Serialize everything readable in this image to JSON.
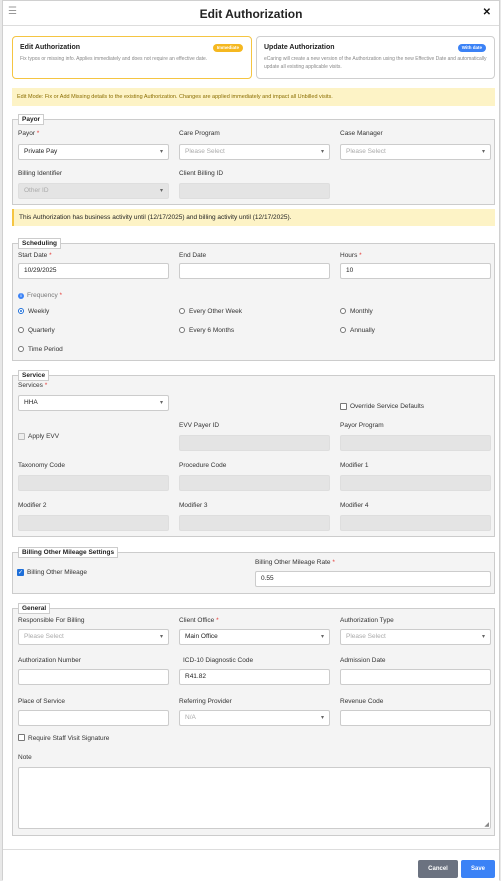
{
  "header": {
    "title": "Edit Authorization"
  },
  "cards": {
    "edit": {
      "title": "Edit Authorization",
      "badge": "Immediate",
      "desc": "Fix typos or missing info. Applies immediately and does not require an effective date."
    },
    "update": {
      "title": "Update Authorization",
      "badge": "With date",
      "desc": "eCaring will create a new version of the Authorization using the new Effective Date and automatically update all existing applicable visits."
    }
  },
  "edit_mode_note": "Edit Mode: Fix or Add Missing details to the existing Authorization. Changes are applied immediately and impact all Unbilled visits.",
  "payor": {
    "legend": "Payor",
    "payor_label": "Payor",
    "payor_value": "Private Pay",
    "care_program_label": "Care Program",
    "care_program_placeholder": "Please Select",
    "case_manager_label": "Case Manager",
    "case_manager_placeholder": "Please Select",
    "billing_identifier_label": "Billing Identifier",
    "billing_identifier_placeholder": "Other ID",
    "client_billing_id_label": "Client Billing ID"
  },
  "activity_note": "This Authorization has business activity until (12/17/2025) and billing activity until (12/17/2025).",
  "scheduling": {
    "legend": "Scheduling",
    "start_date_label": "Start Date",
    "start_date_value": "10/29/2025",
    "end_date_label": "End Date",
    "hours_label": "Hours",
    "hours_value": "10",
    "frequency_label": "Frequency",
    "options": [
      "Weekly",
      "Every Other Week",
      "Monthly",
      "Quarterly",
      "Every 6 Months",
      "Annually",
      "Time Period"
    ],
    "selected": "Weekly"
  },
  "service": {
    "legend": "Service",
    "services_label": "Services",
    "services_value": "HHA",
    "override_label": "Override Service Defaults",
    "apply_evv_label": "Apply EVV",
    "evv_payer_id_label": "EVV Payer ID",
    "payor_program_label": "Payor Program",
    "taxonomy_label": "Taxonomy Code",
    "procedure_label": "Procedure Code",
    "modifier1_label": "Modifier 1",
    "modifier2_label": "Modifier 2",
    "modifier3_label": "Modifier 3",
    "modifier4_label": "Modifier 4"
  },
  "mileage": {
    "legend": "Billing Other Mileage Settings",
    "checkbox_label": "Billing Other Mileage",
    "rate_label": "Billing Other Mileage Rate",
    "rate_value": "0.55"
  },
  "general": {
    "legend": "General",
    "responsible_label": "Responsible For Billing",
    "responsible_placeholder": "Please Select",
    "client_office_label": "Client Office",
    "client_office_value": "Main Office",
    "auth_type_label": "Authorization Type",
    "auth_type_placeholder": "Please Select",
    "auth_number_label": "Authorization Number",
    "icd10_label": "ICD-10 Diagnostic Code",
    "icd10_value": "R41.82",
    "admission_label": "Admission Date",
    "place_label": "Place of Service",
    "referring_label": "Referring Provider",
    "referring_value": "N/A",
    "revenue_label": "Revenue Code",
    "signature_label": "Require Staff Visit Signature",
    "note_label": "Note"
  },
  "footer": {
    "cancel_label": "Cancel",
    "save_label": "Save"
  },
  "colors": {
    "primary": "#3b82f6",
    "warning_bg": "#fdf3c6",
    "badge_immediate": "#f5b820",
    "required": "#e53935"
  },
  "icons": {
    "menu": "hamburger-icon",
    "close": "close-icon",
    "info": "info-icon",
    "caret": "chevron-down-icon"
  }
}
